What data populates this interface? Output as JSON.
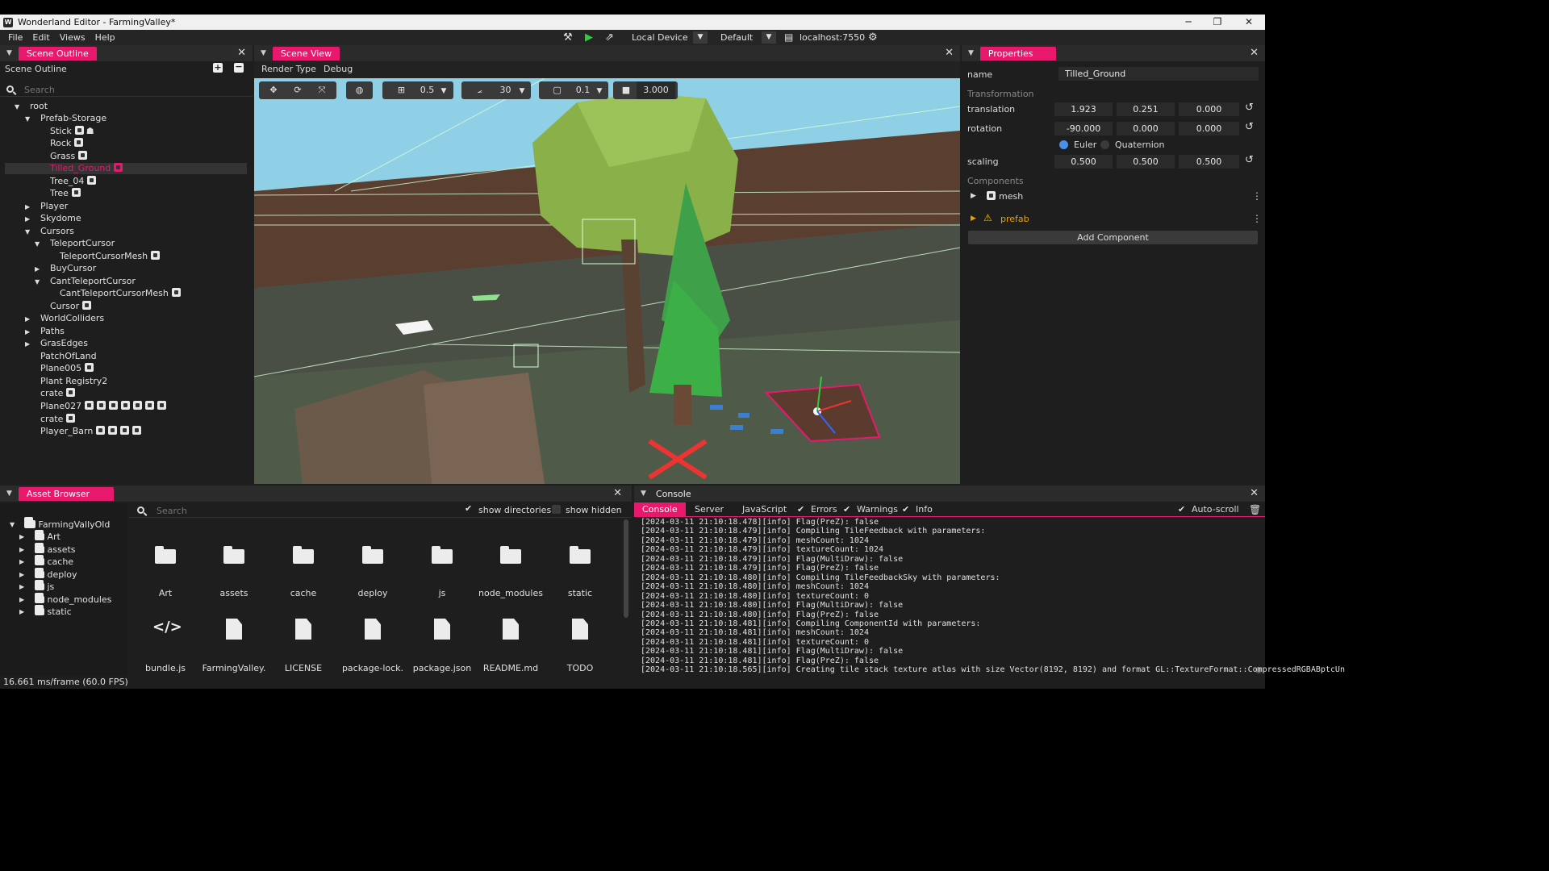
{
  "window": {
    "title": "Wonderland Editor - FarmingValley*"
  },
  "menu": [
    "File",
    "Edit",
    "Views",
    "Help"
  ],
  "toolbar": {
    "device": "Local Device",
    "profile": "Default",
    "server": "localhost:7550"
  },
  "outline": {
    "tab": "Scene Outline",
    "title": "Scene Outline",
    "search_placeholder": "Search",
    "nodes": [
      "root",
      "Prefab-Storage",
      "Stick",
      "Rock",
      "Grass",
      "Tilled_Ground",
      "Tree_04",
      "Tree",
      "Player",
      "Skydome",
      "Cursors",
      "TeleportCursor",
      "TeleportCursorMesh",
      "BuyCursor",
      "CantTeleportCursor",
      "CantTeleportCursorMesh",
      "Cursor",
      "WorldColliders",
      "Paths",
      "GrasEdges",
      "PatchOfLand",
      "Plane005",
      "Plant Registry2",
      "crate",
      "Plane027",
      "crate",
      "Player_Barn"
    ]
  },
  "sceneview": {
    "tab": "Scene View",
    "menu": [
      "Render Type",
      "Debug"
    ],
    "grid_snap": "0.5",
    "angle_snap": "30",
    "scale_snap": "0.1",
    "camera_speed": "3.000"
  },
  "properties": {
    "tab": "Properties",
    "name_label": "name",
    "name_value": "Tilled_Ground",
    "transformation_label": "Transformation",
    "translation_label": "translation",
    "translation": [
      "1.923",
      "0.251",
      "0.000"
    ],
    "rotation_label": "rotation",
    "rotation": [
      "-90.000",
      "0.000",
      "0.000"
    ],
    "euler": "Euler",
    "quaternion": "Quaternion",
    "scaling_label": "scaling",
    "scaling": [
      "0.500",
      "0.500",
      "0.500"
    ],
    "components_label": "Components",
    "components": [
      "mesh",
      "prefab"
    ],
    "add_component": "Add Component"
  },
  "assets": {
    "tab": "Asset Browser",
    "root": "FarmingVallyOld",
    "tree": [
      "Art",
      "assets",
      "cache",
      "deploy",
      "js",
      "node_modules",
      "static"
    ],
    "search_placeholder": "Search",
    "show_directories": "show directories",
    "show_hidden": "show hidden",
    "folders": [
      "Art",
      "assets",
      "cache",
      "deploy",
      "js",
      "node_modules",
      "static"
    ],
    "files": [
      "bundle.js",
      "FarmingValley.",
      "LICENSE",
      "package-lock.",
      "package.json",
      "README.md",
      "TODO"
    ]
  },
  "console": {
    "tab": "Console",
    "tabs": [
      "Console",
      "Server",
      "JavaScript"
    ],
    "filters": [
      "Errors",
      "Warnings",
      "Info"
    ],
    "autoscroll": "Auto-scroll",
    "lines": [
      "[2024-03-11 21:10:18.478][info]     Flag(PreZ): false",
      "[2024-03-11 21:10:18.479][info] Compiling TileFeedback with parameters:",
      "[2024-03-11 21:10:18.479][info]     meshCount: 1024",
      "[2024-03-11 21:10:18.479][info]     textureCount: 1024",
      "[2024-03-11 21:10:18.479][info]     Flag(MultiDraw): false",
      "[2024-03-11 21:10:18.479][info]     Flag(PreZ): false",
      "[2024-03-11 21:10:18.480][info] Compiling TileFeedbackSky with parameters:",
      "[2024-03-11 21:10:18.480][info]     meshCount: 1024",
      "[2024-03-11 21:10:18.480][info]     textureCount: 0",
      "[2024-03-11 21:10:18.480][info]     Flag(MultiDraw): false",
      "[2024-03-11 21:10:18.480][info]     Flag(PreZ): false",
      "[2024-03-11 21:10:18.481][info] Compiling ComponentId with parameters:",
      "[2024-03-11 21:10:18.481][info]     meshCount: 1024",
      "[2024-03-11 21:10:18.481][info]     textureCount: 0",
      "[2024-03-11 21:10:18.481][info]     Flag(MultiDraw): false",
      "[2024-03-11 21:10:18.481][info]     Flag(PreZ): false",
      "[2024-03-11 21:10:18.565][info] Creating tile stack texture atlas with size Vector(8192, 8192) and format GL::TextureFormat::CompressedRGBABptcUn"
    ]
  },
  "status": {
    "fps": "16.661 ms/frame (60.0 FPS)"
  },
  "colors": {
    "accent": "#e8196d",
    "panel": "#1e1e1e",
    "sky": "#8fd0e6",
    "grass": "#4f5a48"
  }
}
